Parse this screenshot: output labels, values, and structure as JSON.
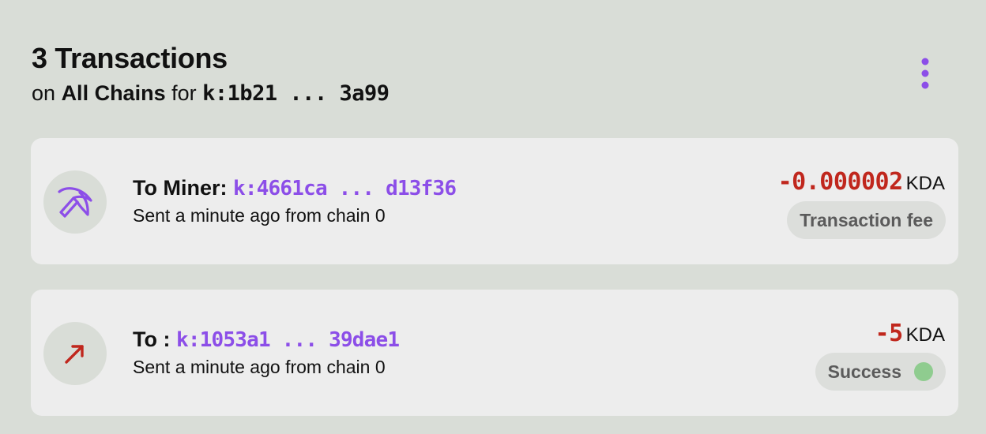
{
  "header": {
    "title": "3 Transactions",
    "on_text": "on",
    "chain_scope": "All Chains",
    "for_text": "for",
    "account": "k:1b21 ... 3a99",
    "menu_icon": "kebab-vertical-icon"
  },
  "transactions": [
    {
      "icon": "pickaxe-icon",
      "label": "To Miner:",
      "address": "k:4661ca ... d13f36",
      "subtitle": "Sent a minute ago from chain 0",
      "amount": "-0.000002",
      "unit": "KDA",
      "tag": "Transaction fee"
    },
    {
      "icon": "arrow-up-right-icon",
      "label": "To :",
      "address": "k:1053a1 ... 39dae1",
      "subtitle": "Sent a minute ago from chain 0",
      "amount": "-5",
      "unit": "KDA",
      "tag": "Success"
    }
  ],
  "colors": {
    "background": "#d9ddd7",
    "card": "#ededed",
    "accent_purple": "#8c4ee8",
    "negative_red": "#c0271d",
    "success_green": "#8fcc8f"
  }
}
